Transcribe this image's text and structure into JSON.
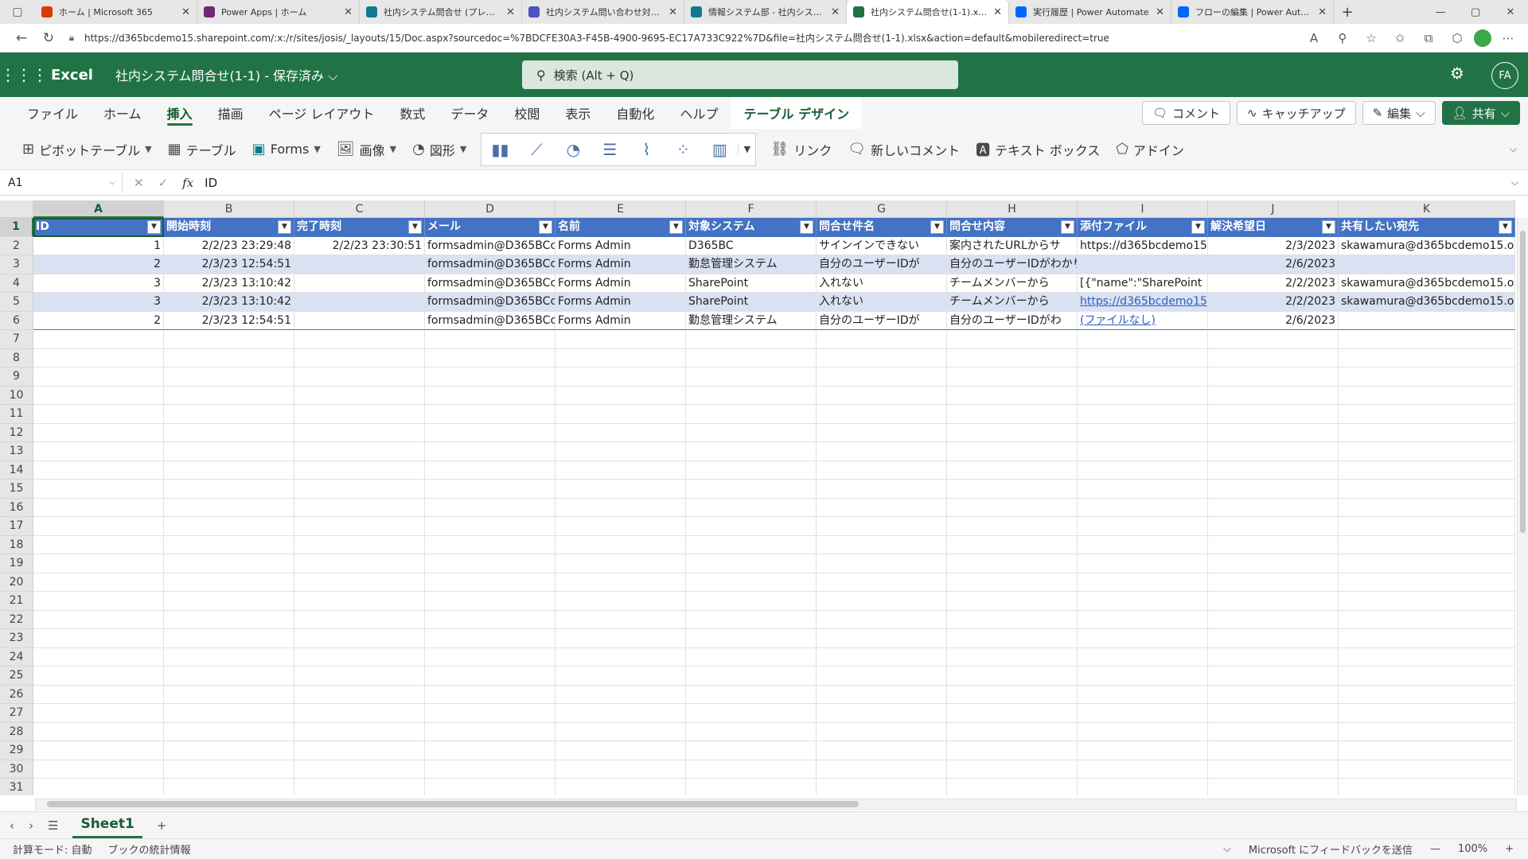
{
  "browser": {
    "tabs": [
      {
        "label": "ホーム | Microsoft 365",
        "color": "#d83b01"
      },
      {
        "label": "Power Apps | ホーム",
        "color": "#742774"
      },
      {
        "label": "社内システム問合せ (プレビュー)",
        "color": "#0f7b8c"
      },
      {
        "label": "社内システム問い合わせ対応 (ii",
        "color": "#4b53bc"
      },
      {
        "label": "情報システム部 - 社内システム...",
        "color": "#0f7b8c"
      },
      {
        "label": "社内システム問合せ(1-1).xlsx",
        "color": "#217346",
        "active": true
      },
      {
        "label": "実行履歴 | Power Automate",
        "color": "#0066ff"
      },
      {
        "label": "フローの編集 | Power Automate",
        "color": "#0066ff"
      }
    ],
    "url": "https://d365bcdemo15.sharepoint.com/:x:/r/sites/josis/_layouts/15/Doc.aspx?sourcedoc=%7BDCFE30A3-F45B-4900-9695-EC17A733C922%7D&file=社内システム問合せ(1-1).xlsx&action=default&mobileredirect=true"
  },
  "app": {
    "name": "Excel",
    "doc_title": "社内システム問合せ(1-1) - 保存済み",
    "search_placeholder": "検索 (Alt + Q)",
    "avatar_initials": "FA"
  },
  "ribbon_tabs": [
    "ファイル",
    "ホーム",
    "挿入",
    "描画",
    "ページ レイアウト",
    "数式",
    "データ",
    "校閲",
    "表示",
    "自動化",
    "ヘルプ",
    "テーブル デザイン"
  ],
  "active_ribbon_tab": "挿入",
  "right_buttons": {
    "comment": "コメント",
    "catchup": "キャッチアップ",
    "edit": "編集",
    "share": "共有"
  },
  "commands": {
    "pivot": "ピボットテーブル",
    "table": "テーブル",
    "forms": "Forms",
    "image": "画像",
    "shapes": "図形",
    "link": "リンク",
    "new_comment": "新しいコメント",
    "textbox": "テキスト ボックス",
    "addin": "アドイン"
  },
  "formula_bar": {
    "name_box": "A1",
    "value": "ID"
  },
  "grid": {
    "columns": [
      "A",
      "B",
      "C",
      "D",
      "E",
      "F",
      "G",
      "H",
      "I",
      "J",
      "K"
    ],
    "row_numbers": [
      "1",
      "2",
      "3",
      "4",
      "5",
      "6",
      "7",
      "8",
      "9",
      "10",
      "11",
      "12",
      "13",
      "14",
      "15",
      "16",
      "17",
      "18",
      "19",
      "20",
      "21",
      "22",
      "23",
      "24",
      "25",
      "26",
      "27",
      "28",
      "29",
      "30",
      "31"
    ],
    "headers": [
      "ID",
      "開始時刻",
      "完了時刻",
      "メール",
      "名前",
      "対象システム",
      "問合せ件名",
      "問合せ内容",
      "添付ファイル",
      "解決希望日",
      "共有したい宛先"
    ],
    "rows": [
      [
        "1",
        "2/2/23 23:29:48",
        "2/2/23 23:30:51",
        "formsadmin@D365BCc",
        "Forms Admin",
        "D365BC",
        "サインインできない",
        "案内されたURLからサ",
        "https://d365bcdemo15",
        "2/3/2023",
        "skawamura@d365bcdemo15.o"
      ],
      [
        "2",
        "2/3/23 12:54:51",
        "",
        "formsadmin@D365BCc",
        "Forms Admin",
        "勤怠管理システム",
        "自分のユーザーIDが",
        "自分のユーザーIDがわかりません。社員番",
        "",
        "2/6/2023",
        ""
      ],
      [
        "3",
        "2/3/23 13:10:42",
        "",
        "formsadmin@D365BCc",
        "Forms Admin",
        "SharePoint",
        "入れない",
        "チームメンバーから",
        "[{\"name\":\"SharePoint",
        "2/2/2023",
        "skawamura@d365bcdemo15.o"
      ],
      [
        "3",
        "2/3/23 13:10:42",
        "",
        "formsadmin@D365BCc",
        "Forms Admin",
        "SharePoint",
        "入れない",
        "チームメンバーから",
        "https://d365bcdemo15",
        "2/2/2023",
        "skawamura@d365bcdemo15.o"
      ],
      [
        "2",
        "2/3/23 12:54:51",
        "",
        "formsadmin@D365BCc",
        "Forms Admin",
        "勤怠管理システム",
        "自分のユーザーIDが",
        "自分のユーザーIDがわ",
        "(ファイルなし)",
        "2/6/2023",
        ""
      ]
    ]
  },
  "sheet_tab": "Sheet1",
  "status": {
    "calc_mode": "計算モード: 自動",
    "workbook_stats": "ブックの統計情報",
    "feedback": "Microsoft にフィードバックを送信",
    "zoom": "100%"
  }
}
